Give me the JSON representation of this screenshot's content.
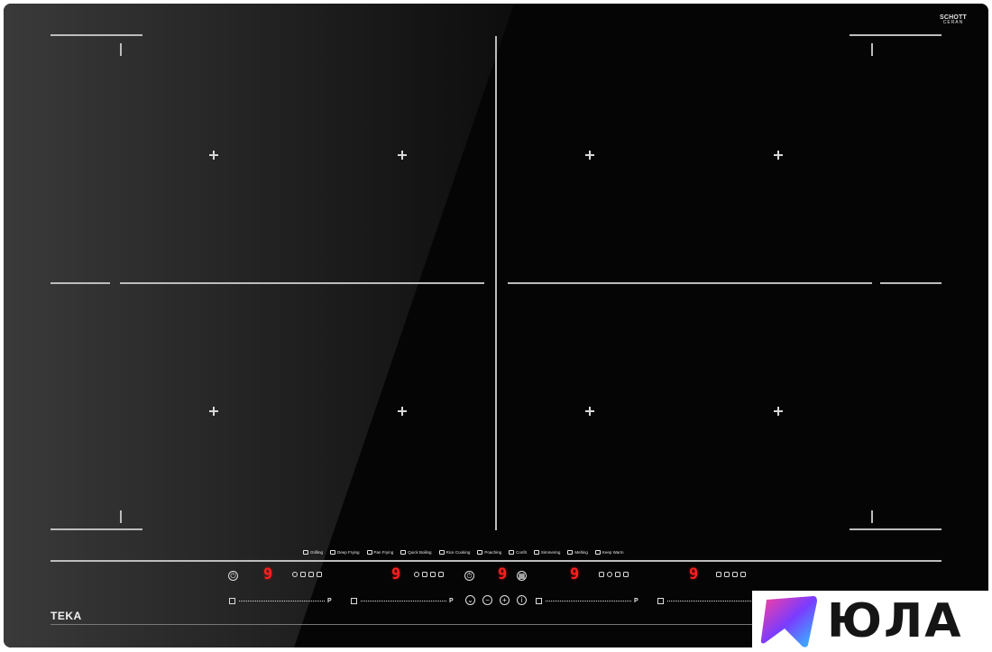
{
  "brand": "TEKA",
  "glass_badge": {
    "line1": "SCHOTT",
    "line2": "CERAN"
  },
  "cooking_modes": [
    "Grilling",
    "Deep Frying",
    "Pan Frying",
    "Quick Boiling",
    "Rice Cooking",
    "Poaching",
    "Confit",
    "Simmering",
    "Melting",
    "Keep Warm"
  ],
  "zones": [
    {
      "id": "zone-1",
      "level": "9"
    },
    {
      "id": "zone-2",
      "level": "9"
    },
    {
      "id": "center",
      "level": "9"
    },
    {
      "id": "zone-3",
      "level": "9"
    },
    {
      "id": "zone-4",
      "level": "9"
    }
  ],
  "slider_end_label": "P",
  "controls": {
    "minus": "−",
    "plus": "+"
  },
  "watermark": {
    "text": "ЮЛА",
    "colors": [
      "#ff3f9a",
      "#7a3cff",
      "#2cc8ff"
    ]
  }
}
